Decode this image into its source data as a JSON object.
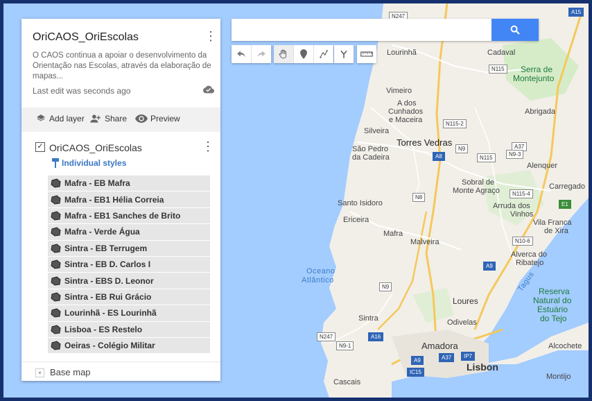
{
  "panel": {
    "title": "OriCAOS_OriEscolas",
    "description": "O CAOS continua a apoiar o desenvolvimento da Orientação nas Escolas, através da elaboração de mapas...",
    "last_edit": "Last edit was seconds ago",
    "actions": {
      "add_layer": "Add layer",
      "share": "Share",
      "preview": "Preview"
    },
    "layer": {
      "name": "OriCAOS_OriEscolas",
      "style": "Individual styles",
      "items": [
        "Mafra - EB Mafra",
        "Mafra - EB1 Hélia Correia",
        "Mafra - EB1 Sanches de Brito",
        "Mafra - Verde Água",
        "Sintra - EB Terrugem",
        "Sintra - EB D. Carlos I",
        "Sintra - EBS D. Leonor",
        "Sintra - EB Rui Grácio",
        "Lourinhã - ES Lourinhã",
        "Lisboa - ES Restelo",
        "Oeiras - Colégio Militar"
      ]
    },
    "base_map": "Base map"
  },
  "search": {
    "value": "",
    "placeholder": ""
  },
  "toolbar": {
    "icons": [
      "undo-icon",
      "redo-icon",
      "hand-icon",
      "marker-icon",
      "line-icon",
      "directions-icon",
      "ruler-icon"
    ]
  },
  "map": {
    "places": {
      "lourinha": "Lourinhã",
      "cadaval": "Cadaval",
      "serra": "Serra de",
      "montejunto": "Montejunto",
      "vimeiro": "Vimeiro",
      "a_dos": "A dos",
      "cunhados": "Cunhados",
      "e_maceira": "e Maceira",
      "abrigada": "Abrigada",
      "silveira": "Silveira",
      "torres_vedras": "Torres Vedras",
      "sao_pedro": "São Pedro",
      "da_cadeira": "da Cadeira",
      "alenquer": "Alenquer",
      "sobral": "Sobral de",
      "monte_agraco": "Monte Agraço",
      "carregado": "Carregado",
      "santo_isidoro": "Santo Isidoro",
      "arruda": "Arruda dos",
      "vinhos": "Vinhos",
      "ericeira": "Ericeira",
      "mafra": "Mafra",
      "vila_franca": "Vila Franca",
      "de_xira": "de Xira",
      "malveira": "Malveira",
      "alverca": "Alverca do",
      "ribatejo": "Ribatejo",
      "oceano": "Oceano",
      "atlantico": "Atlântico",
      "tagus": "Tagus",
      "reserva": "Reserva",
      "natural_do": "Natural do",
      "estuario": "Estuário",
      "do_tejo": "do Tejo",
      "loures": "Loures",
      "sintra": "Sintra",
      "odivelas": "Odivelas",
      "amadora": "Amadora",
      "lisbon": "Lisbon",
      "cascais": "Cascais",
      "alcochete": "Alcochete",
      "montijo": "Montijo"
    },
    "roads": [
      "N247",
      "A15",
      "N115",
      "N115-2",
      "N9",
      "N9-3",
      "A8",
      "N8",
      "N115-4",
      "E1",
      "N10-6",
      "A9",
      "N9",
      "A16",
      "N247",
      "N9-1",
      "A37",
      "IP7",
      "A9",
      "IC15"
    ]
  },
  "colors": {
    "accent": "#4285f4",
    "frame": "#16306e",
    "water": "#a3ccff",
    "land": "#f2efe9"
  }
}
